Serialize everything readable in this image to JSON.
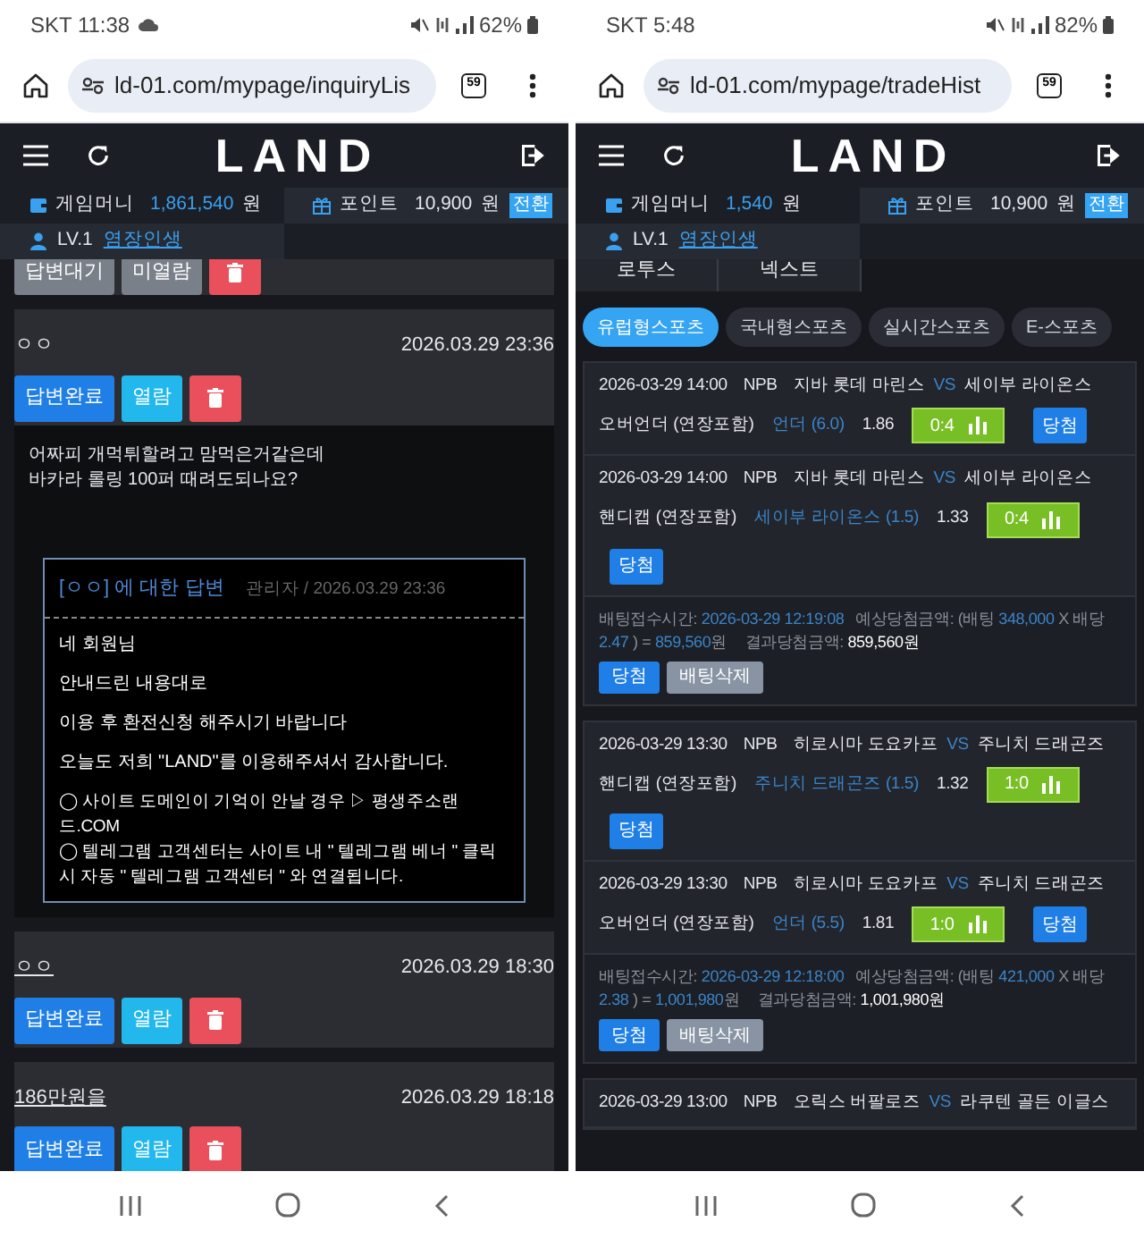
{
  "phones": [
    {
      "kind": "inquiry_list",
      "status_bar": {
        "carrier": "SKT",
        "time": "11:38",
        "cloud": true,
        "battery": "62%"
      },
      "browser": {
        "url": "ld-01.com/mypage/inquiryLis",
        "tab_count": "59"
      },
      "header": {
        "logo": "LAND"
      },
      "wallet": {
        "money_label": "게임머니",
        "money": "1,861,540",
        "money_unit": "원",
        "point_label": "포인트",
        "points": "10,900",
        "point_unit": "원",
        "convert_button": "전환"
      },
      "user": {
        "level": "LV.1",
        "nickname": "염장인생"
      },
      "inquiries": [
        {
          "clipped": true,
          "status": {
            "label": "답변대기",
            "kind": "pending"
          },
          "read": {
            "label": "미열람",
            "kind": "unread"
          }
        },
        {
          "clipped": false,
          "title": "ㅇㅇ",
          "date": "2026.03.29 23:36",
          "status": {
            "label": "답변완료",
            "kind": "answered"
          },
          "read": {
            "label": "열람",
            "kind": "read"
          },
          "expanded": true,
          "question_lines": [
            "어짜피 개먹튀할려고 맘먹은거같은데",
            "바카라 롤링 100퍼 때려도되나요?"
          ],
          "answer": {
            "title": "[ㅇㅇ] 에 대한 답변",
            "meta": "관리자 / 2026.03.29 23:36",
            "paragraphs": [
              "네 회원님",
              "안내드린 내용대로",
              "이용 후 환전신청 해주시기 바랍니다",
              "오늘도 저희 \"LAND\"를 이용해주셔서 감사합니다."
            ],
            "notes": [
              "◯ 사이트 도메인이 기억이 안날 경우 ▷ 평생주소랜드.COM",
              "◯ 텔레그램 고객센터는 사이트 내 \" 텔레그램 베너 \" 클릭 시 자동 \" 텔레그램 고객센터 \" 와 연결됩니다."
            ]
          }
        },
        {
          "clipped": false,
          "title": "ㅇㅇ",
          "date": "2026.03.29 18:30",
          "status": {
            "label": "답변완료",
            "kind": "answered"
          },
          "read": {
            "label": "열람",
            "kind": "read"
          },
          "expanded": false
        },
        {
          "clipped": false,
          "title": "186만원을",
          "date": "2026.03.29 18:18",
          "status": {
            "label": "답변완료",
            "kind": "answered"
          },
          "read": {
            "label": "열람",
            "kind": "read"
          },
          "expanded": false
        }
      ]
    },
    {
      "kind": "bet_history",
      "status_bar": {
        "carrier": "SKT",
        "time": "5:48",
        "cloud": false,
        "battery": "82%"
      },
      "browser": {
        "url": "ld-01.com/mypage/tradeHist",
        "tab_count": "59"
      },
      "header": {
        "logo": "LAND"
      },
      "wallet": {
        "money_label": "게임머니",
        "money": "1,540",
        "money_unit": "원",
        "point_label": "포인트",
        "points": "10,900",
        "point_unit": "원",
        "convert_button": "전환"
      },
      "user": {
        "level": "LV.1",
        "nickname": "염장인생"
      },
      "menu_tabs": [
        "로투스",
        "넥스트"
      ],
      "sport_tabs": [
        {
          "label": "유럽형스포츠",
          "selected": true
        },
        {
          "label": "국내형스포츠",
          "selected": false
        },
        {
          "label": "실시간스포츠",
          "selected": false
        },
        {
          "label": "E-스포츠",
          "selected": false
        }
      ],
      "bets": [
        {
          "selections": [
            {
              "date": "2026-03-29 14:00",
              "league": "NPB",
              "home": "지바 롯데 마린스",
              "vs": "VS",
              "away": "세이부 라이온스",
              "market": "오버언더 (연장포함)",
              "pick": "언더 (6.0)",
              "odds": "1.86",
              "score": "0:4",
              "result": "당첨"
            },
            {
              "date": "2026-03-29 14:00",
              "league": "NPB",
              "home": "지바 롯데 마린스",
              "vs": "VS",
              "away": "세이부 라이온스",
              "market": "핸디캡 (연장포함)",
              "pick": "세이부 라이온스 (1.5)",
              "odds": "1.33",
              "score": "0:4",
              "result": "당첨"
            }
          ],
          "summary": {
            "time_label": "배팅접수시간:",
            "time": "2026-03-29 12:19:08",
            "expected_label": "예상당첨금액: (배팅",
            "stake": "348,000",
            "odds_label": "X 배당",
            "odds": "2.47",
            "equals": ") =",
            "payout": "859,560",
            "payout_unit": "원",
            "result_label": "결과당첨금액:",
            "result": "859,560원"
          },
          "buttons": [
            {
              "label": "당첨",
              "kind": "result"
            },
            {
              "label": "배팅삭제",
              "kind": "delete"
            }
          ]
        },
        {
          "selections": [
            {
              "date": "2026-03-29 13:30",
              "league": "NPB",
              "home": "히로시마 도요카프",
              "vs": "VS",
              "away": "주니치 드래곤즈",
              "market": "핸디캡 (연장포함)",
              "pick": "주니치 드래곤즈 (1.5)",
              "odds": "1.32",
              "score": "1:0",
              "result": "당첨"
            },
            {
              "date": "2026-03-29 13:30",
              "league": "NPB",
              "home": "히로시마 도요카프",
              "vs": "VS",
              "away": "주니치 드래곤즈",
              "market": "오버언더 (연장포함)",
              "pick": "언더 (5.5)",
              "odds": "1.81",
              "score": "1:0",
              "result": "당첨"
            }
          ],
          "summary": {
            "time_label": "배팅접수시간:",
            "time": "2026-03-29 12:18:00",
            "expected_label": "예상당첨금액: (배팅",
            "stake": "421,000",
            "odds_label": "X 배당",
            "odds": "2.38",
            "equals": ") =",
            "payout": "1,001,980",
            "payout_unit": "원",
            "result_label": "결과당첨금액:",
            "result": "1,001,980원"
          },
          "buttons": [
            {
              "label": "당첨",
              "kind": "result"
            },
            {
              "label": "배팅삭제",
              "kind": "delete"
            }
          ]
        },
        {
          "selections": [
            {
              "date": "2026-03-29 13:00",
              "league": "NPB",
              "home": "오릭스 버팔로즈",
              "vs": "VS",
              "away": "라쿠텐 골든 이글스"
            }
          ]
        }
      ]
    }
  ]
}
